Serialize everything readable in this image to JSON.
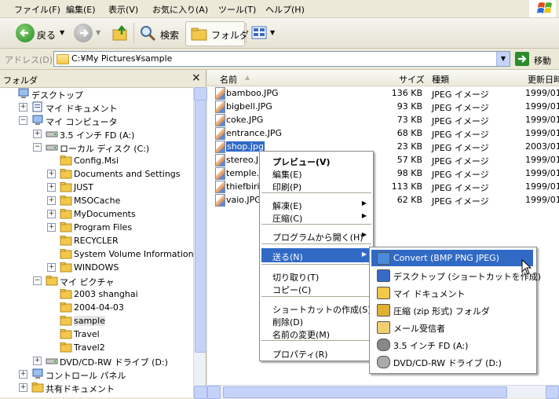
{
  "menubar": {
    "items": [
      "ファイル(F)",
      "編集(E)",
      "表示(V)",
      "お気に入り(A)",
      "ツール(T)",
      "ヘルプ(H)"
    ]
  },
  "toolbar": {
    "back_label": "戻る",
    "search_label": "検索",
    "folder_label": "フォルダ"
  },
  "address": {
    "label": "アドレス(D)",
    "value": "C:¥My Pictures¥sample",
    "go_label": "移動"
  },
  "folder_pane": {
    "title": "フォルダ",
    "close": "×",
    "tree": [
      {
        "label": "デスクトップ",
        "icon": "desktop-icon"
      },
      {
        "label": "マイ ドキュメント",
        "icon": "my-documents-icon",
        "expander": "+"
      },
      {
        "label": "マイ コンピュータ",
        "icon": "my-computer-icon",
        "expander": "-"
      },
      {
        "label": "3.5 インチ FD (A:)",
        "icon": "floppy-icon",
        "expander": "+"
      },
      {
        "label": "ローカル ディスク (C:)",
        "icon": "hard-disk-icon",
        "expander": "-"
      },
      {
        "label": "Config.Msi",
        "icon": "folder-icon"
      },
      {
        "label": "Documents and Settings",
        "icon": "folder-icon",
        "expander": "+"
      },
      {
        "label": "JUST",
        "icon": "folder-icon",
        "expander": "+"
      },
      {
        "label": "MSOCache",
        "icon": "folder-icon",
        "expander": "+"
      },
      {
        "label": "MyDocuments",
        "icon": "folder-icon",
        "expander": "+"
      },
      {
        "label": "Program Files",
        "icon": "folder-icon",
        "expander": "+"
      },
      {
        "label": "RECYCLER",
        "icon": "folder-icon"
      },
      {
        "label": "System Volume Information",
        "icon": "folder-icon"
      },
      {
        "label": "WINDOWS",
        "icon": "folder-icon",
        "expander": "+"
      },
      {
        "label": "マイ ピクチャ",
        "icon": "my-pictures-icon",
        "expander": "-"
      },
      {
        "label": "2003 shanghai",
        "icon": "folder-icon"
      },
      {
        "label": "2004-04-03",
        "icon": "folder-icon"
      },
      {
        "label": "sample",
        "icon": "folder-open-icon",
        "selected": true
      },
      {
        "label": "Travel",
        "icon": "folder-icon"
      },
      {
        "label": "Travel2",
        "icon": "folder-icon"
      },
      {
        "label": "DVD/CD-RW ドライブ (D:)",
        "icon": "dvd-drive-icon",
        "expander": "+"
      },
      {
        "label": "コントロール パネル",
        "icon": "control-panel-icon",
        "expander": "+"
      },
      {
        "label": "共有ドキュメント",
        "icon": "folder-icon",
        "expander": "+"
      }
    ]
  },
  "file_list": {
    "columns": [
      "名前",
      "サイズ",
      "種類",
      "更新日時"
    ],
    "rows": [
      {
        "name": "bamboo.JPG",
        "size": "136 KB",
        "type": "JPEG イメージ",
        "date": "1999/01..."
      },
      {
        "name": "bigbell.JPG",
        "size": "93 KB",
        "type": "JPEG イメージ",
        "date": "1999/01..."
      },
      {
        "name": "coke.JPG",
        "size": "73 KB",
        "type": "JPEG イメージ",
        "date": "1999/01..."
      },
      {
        "name": "entrance.JPG",
        "size": "68 KB",
        "type": "JPEG イメージ",
        "date": "1999/01..."
      },
      {
        "name": "shop.jpg",
        "size": "23 KB",
        "type": "JPEG イメージ",
        "date": "2003/01..."
      },
      {
        "name": "stereo.J",
        "size": "57 KB",
        "type": "JPEG イメージ",
        "date": "1999/01..."
      },
      {
        "name": "temple.J",
        "size": "98 KB",
        "type": "JPEG イメージ",
        "date": "1999/01..."
      },
      {
        "name": "thiefbiri",
        "size": "113 KB",
        "type": "JPEG イメージ",
        "date": "1999/01..."
      },
      {
        "name": "vaio.JPG",
        "size": "62 KB",
        "type": "JPEG イメージ",
        "date": "1999/01..."
      }
    ]
  },
  "context_menu": {
    "items": [
      "プレビュー(V)",
      "編集(E)",
      "印刷(P)",
      "解凍(E)",
      "圧縮(C)",
      "プログラムから開く(H)",
      "送る(N)",
      "切り取り(T)",
      "コピー(C)",
      "ショートカットの作成(S)",
      "削除(D)",
      "名前の変更(M)",
      "プロパティ(R)"
    ]
  },
  "sendto_menu": {
    "items": [
      "Convert (BMP PNG JPEG)",
      "デスクトップ (ショートカットを作成)",
      "マイ ドキュメント",
      "圧縮 (zip 形式) フォルダ",
      "メール受信者",
      "3.5 インチ FD (A:)",
      "DVD/CD-RW ドライブ (D:)"
    ]
  },
  "colors": {
    "selection": "#316ac5",
    "accent": "#2a8c2a"
  }
}
